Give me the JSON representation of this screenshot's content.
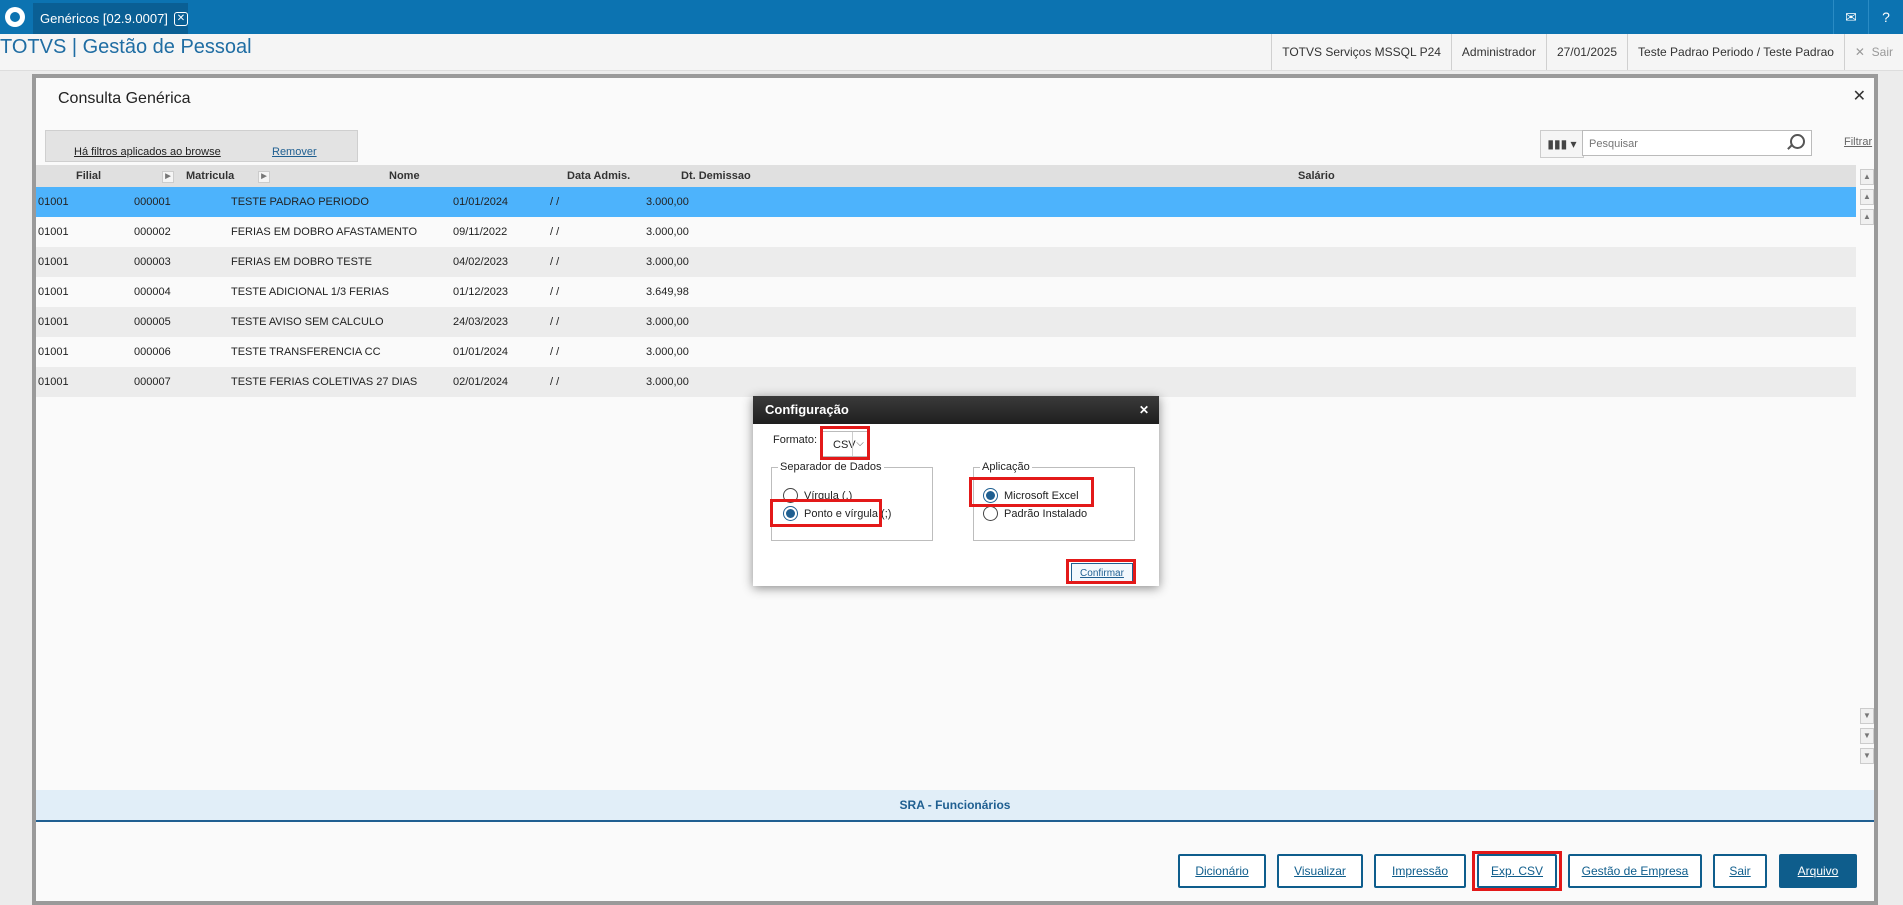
{
  "topbar": {
    "tab_label": "Genéricos [02.9.0007]"
  },
  "header": {
    "title": "TOTVS | Gestão de Pessoal",
    "server": "TOTVS Serviços MSSQL P24",
    "user": "Administrador",
    "date": "27/01/2025",
    "environment": "Teste Padrao Periodo / Teste Padrao",
    "exit_label": "Sair"
  },
  "window": {
    "title": "Consulta Genérica",
    "filters_text": "Há filtros aplicados ao browse",
    "remove_label": "Remover",
    "search_placeholder": "Pesquisar",
    "filter_label": "Filtrar"
  },
  "grid": {
    "columns": [
      "Filial",
      "Matricula",
      "Nome",
      "Data Admis.",
      "Dt. Demissao",
      "Salário"
    ],
    "rows": [
      {
        "filial": "01001",
        "matricula": "000001",
        "nome": "TESTE PADRAO PERIODO",
        "admis": "01/01/2024",
        "demissao": "/ /",
        "salario": "3.000,00"
      },
      {
        "filial": "01001",
        "matricula": "000002",
        "nome": "FERIAS EM DOBRO AFASTAMENTO",
        "admis": "09/11/2022",
        "demissao": "/ /",
        "salario": "3.000,00"
      },
      {
        "filial": "01001",
        "matricula": "000003",
        "nome": "FERIAS EM DOBRO TESTE",
        "admis": "04/02/2023",
        "demissao": "/ /",
        "salario": "3.000,00"
      },
      {
        "filial": "01001",
        "matricula": "000004",
        "nome": "TESTE ADICIONAL 1/3 FERIAS",
        "admis": "01/12/2023",
        "demissao": "/ /",
        "salario": "3.649,98"
      },
      {
        "filial": "01001",
        "matricula": "000005",
        "nome": "TESTE AVISO SEM CALCULO",
        "admis": "24/03/2023",
        "demissao": "/ /",
        "salario": "3.000,00"
      },
      {
        "filial": "01001",
        "matricula": "000006",
        "nome": "TESTE TRANSFERENCIA CC",
        "admis": "01/01/2024",
        "demissao": "/ /",
        "salario": "3.000,00"
      },
      {
        "filial": "01001",
        "matricula": "000007",
        "nome": "TESTE FERIAS COLETIVAS 27 DIAS",
        "admis": "02/01/2024",
        "demissao": "/ /",
        "salario": "3.000,00"
      }
    ]
  },
  "table_label": "SRA - Funcionários",
  "buttons": {
    "dicionario": "Dicionário",
    "visualizar": "Visualizar",
    "impressao": "Impressão",
    "exp_csv": "Exp. CSV",
    "gestao_empresa": "Gestão de Empresa",
    "sair": "Sair",
    "arquivo": "Arquivo"
  },
  "dialog": {
    "title": "Configuração",
    "formato_label": "Formato:",
    "formato_value": "CSV",
    "separador_legend": "Separador de Dados",
    "separador_opt1": "Vírgula (,)",
    "separador_opt2": "Ponto e vírgula (;)",
    "aplicacao_legend": "Aplicação",
    "aplicacao_opt1": "Microsoft Excel",
    "aplicacao_opt2": "Padrão Instalado",
    "confirm_label": "Confirmar"
  }
}
